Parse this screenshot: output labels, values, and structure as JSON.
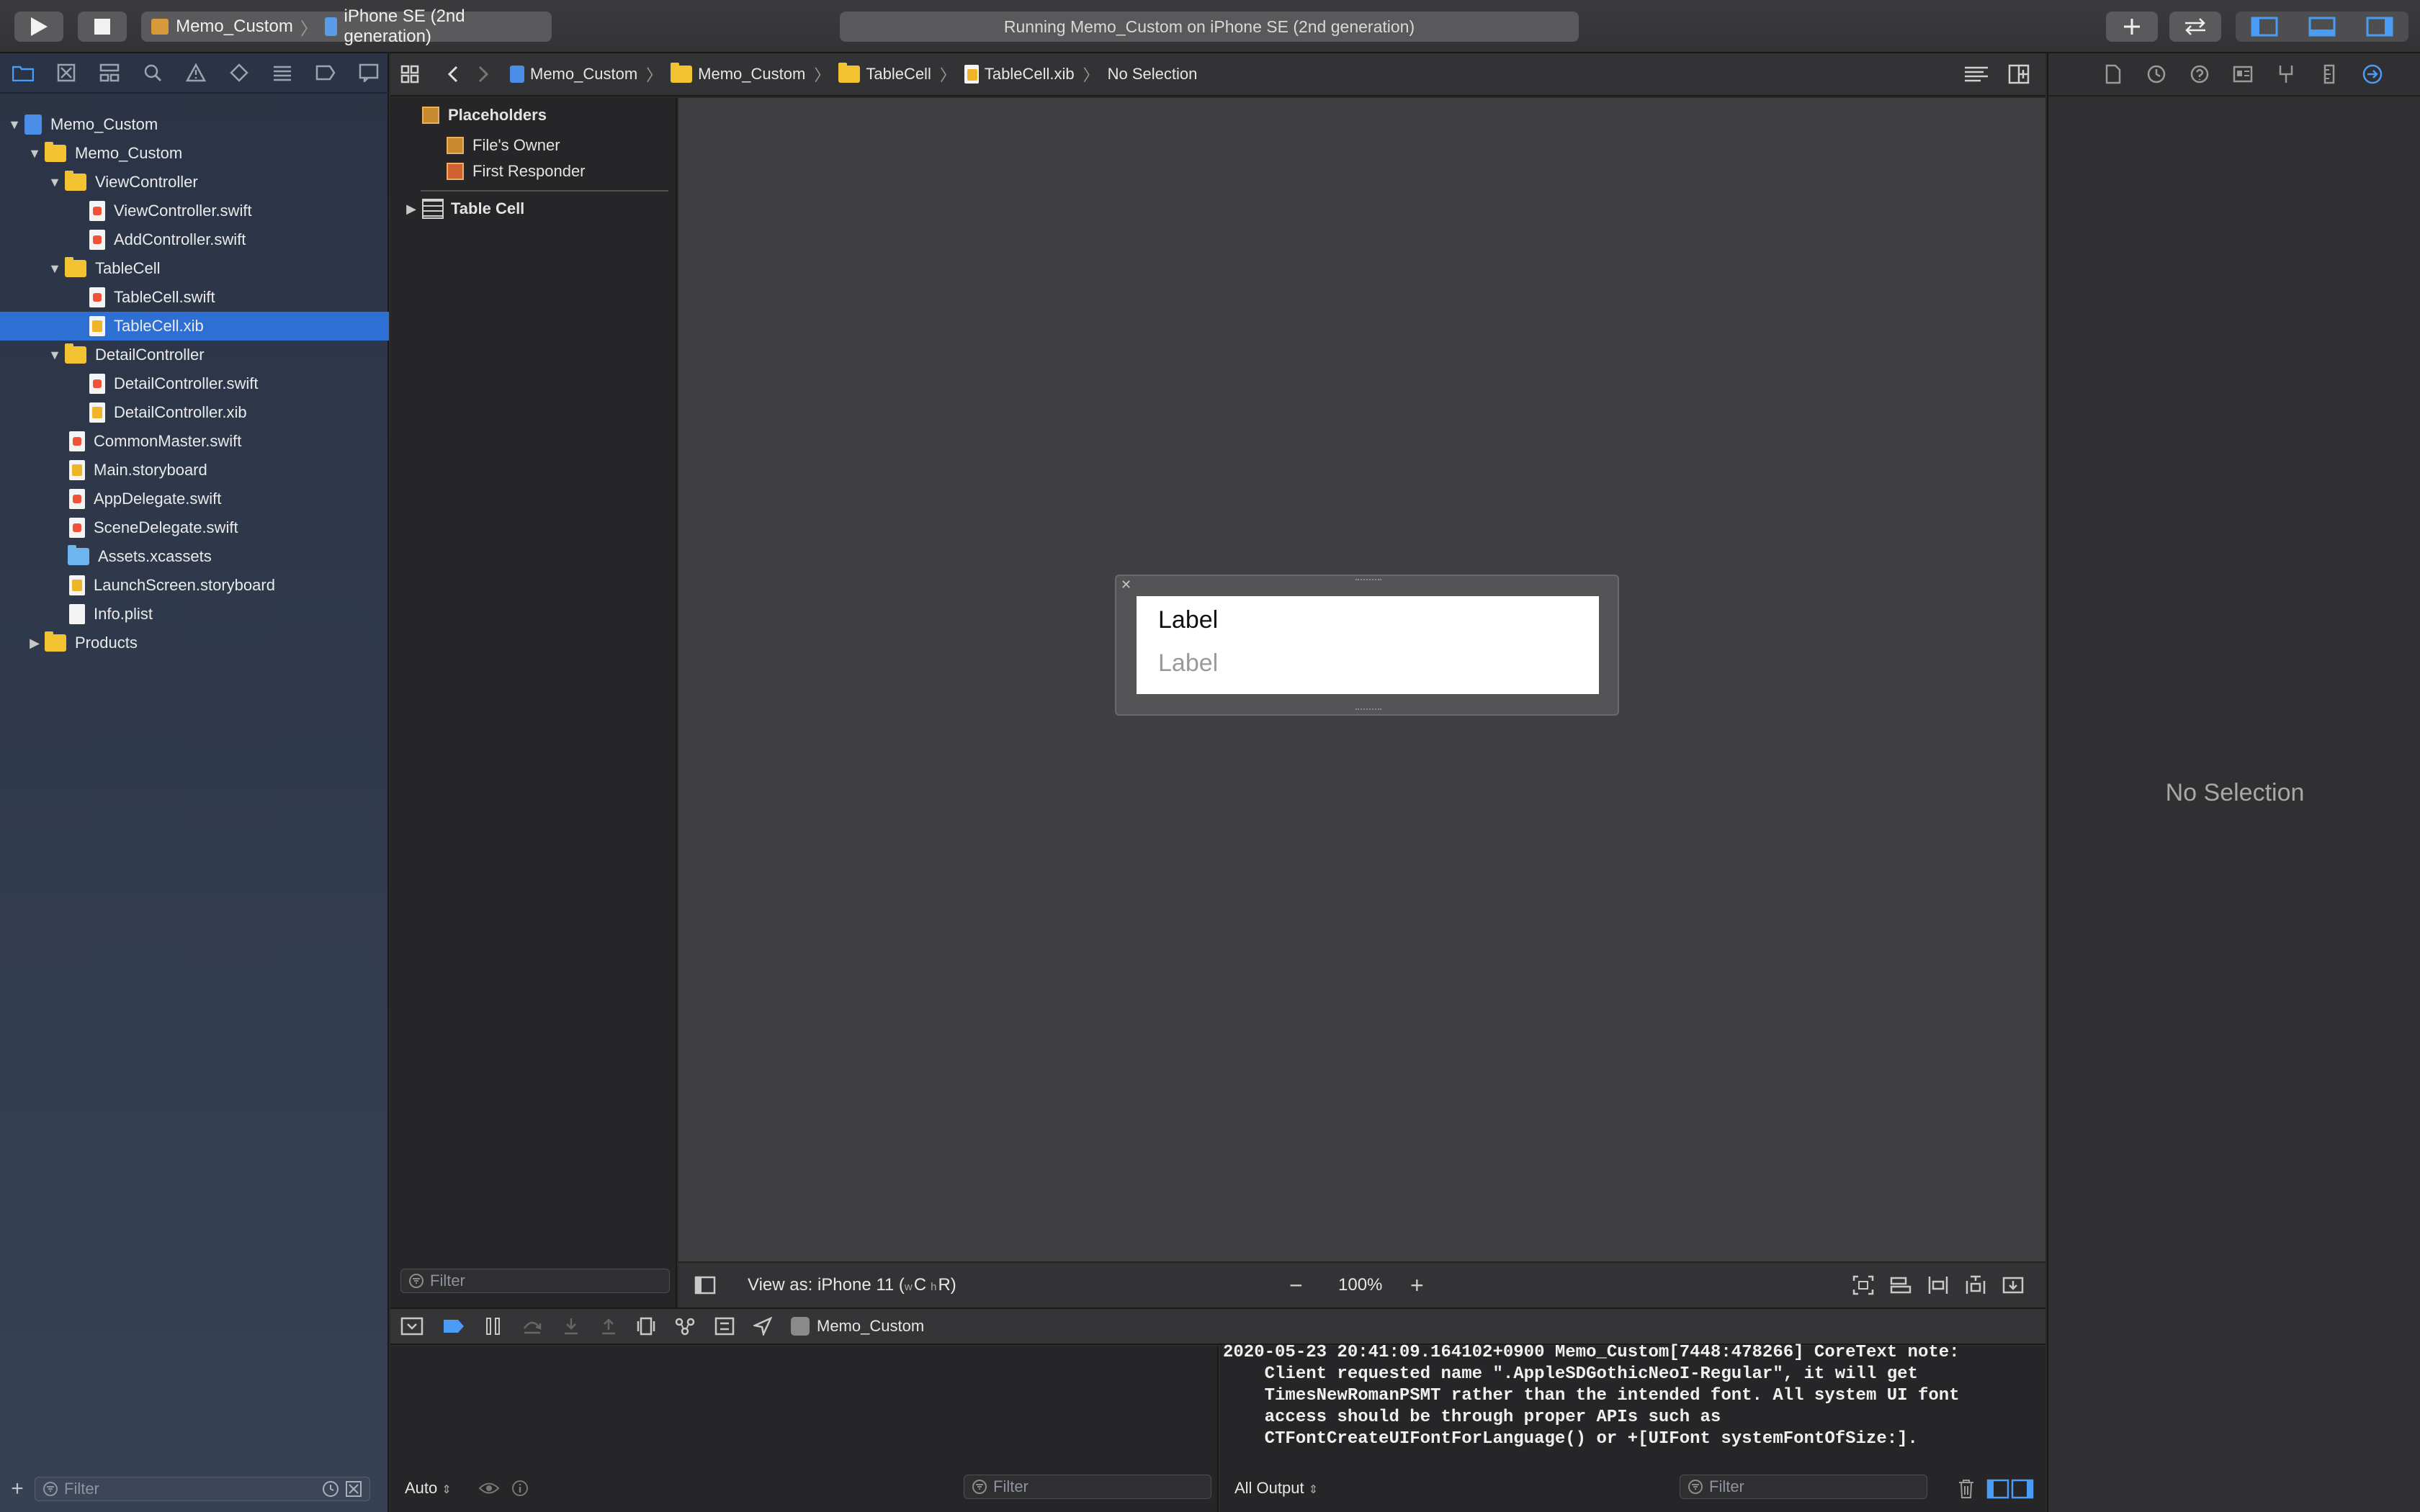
{
  "toolbar": {
    "scheme_project": "Memo_Custom",
    "scheme_device": "iPhone SE (2nd generation)",
    "activity": "Running Memo_Custom on iPhone SE (2nd generation)"
  },
  "navigator": {
    "items": [
      {
        "label": "Memo_Custom",
        "kind": "project"
      },
      {
        "label": "Memo_Custom",
        "kind": "folder"
      },
      {
        "label": "ViewController",
        "kind": "folder"
      },
      {
        "label": "ViewController.swift",
        "kind": "swift"
      },
      {
        "label": "AddController.swift",
        "kind": "swift"
      },
      {
        "label": "TableCell",
        "kind": "folder"
      },
      {
        "label": "TableCell.swift",
        "kind": "swift"
      },
      {
        "label": "TableCell.xib",
        "kind": "xib"
      },
      {
        "label": "DetailController",
        "kind": "folder"
      },
      {
        "label": "DetailController.swift",
        "kind": "swift"
      },
      {
        "label": "DetailController.xib",
        "kind": "xib"
      },
      {
        "label": "CommonMaster.swift",
        "kind": "swift"
      },
      {
        "label": "Main.storyboard",
        "kind": "xib"
      },
      {
        "label": "AppDelegate.swift",
        "kind": "swift"
      },
      {
        "label": "SceneDelegate.swift",
        "kind": "swift"
      },
      {
        "label": "Assets.xcassets",
        "kind": "assets"
      },
      {
        "label": "LaunchScreen.storyboard",
        "kind": "xib"
      },
      {
        "label": "Info.plist",
        "kind": "plist"
      },
      {
        "label": "Products",
        "kind": "folder"
      }
    ],
    "filter_placeholder": "Filter"
  },
  "jumpbar": {
    "crumbs": [
      "Memo_Custom",
      "Memo_Custom",
      "TableCell",
      "TableCell.xib",
      "No Selection"
    ]
  },
  "outline": {
    "placeholders": "Placeholders",
    "files_owner": "File's Owner",
    "first_responder": "First Responder",
    "table_cell": "Table Cell",
    "filter_placeholder": "Filter"
  },
  "canvas": {
    "label_primary": "Label",
    "label_secondary": "Label",
    "view_as": "View as: iPhone 11 (",
    "size_class_w": "w",
    "size_class_c": "C",
    "size_class_h": "h",
    "size_class_r": "R)",
    "zoom": "100%"
  },
  "debug": {
    "target": "Memo_Custom",
    "variables_mode": "Auto",
    "variables_filter": "Filter",
    "output_mode": "All Output",
    "console_filter": "Filter",
    "console_text": "2020-05-23 20:41:09.164102+0900 Memo_Custom[7448:478266] CoreText note:\n    Client requested name \".AppleSDGothicNeoI-Regular\", it will get\n    TimesNewRomanPSMT rather than the intended font. All system UI font\n    access should be through proper APIs such as\n    CTFontCreateUIFontForLanguage() or +[UIFont systemFontOfSize:]."
  },
  "inspector": {
    "no_selection": "No Selection"
  },
  "colors": {
    "accent": "#2e6fd4",
    "icon_active": "#4a9cf5",
    "folder": "#f2c230"
  }
}
